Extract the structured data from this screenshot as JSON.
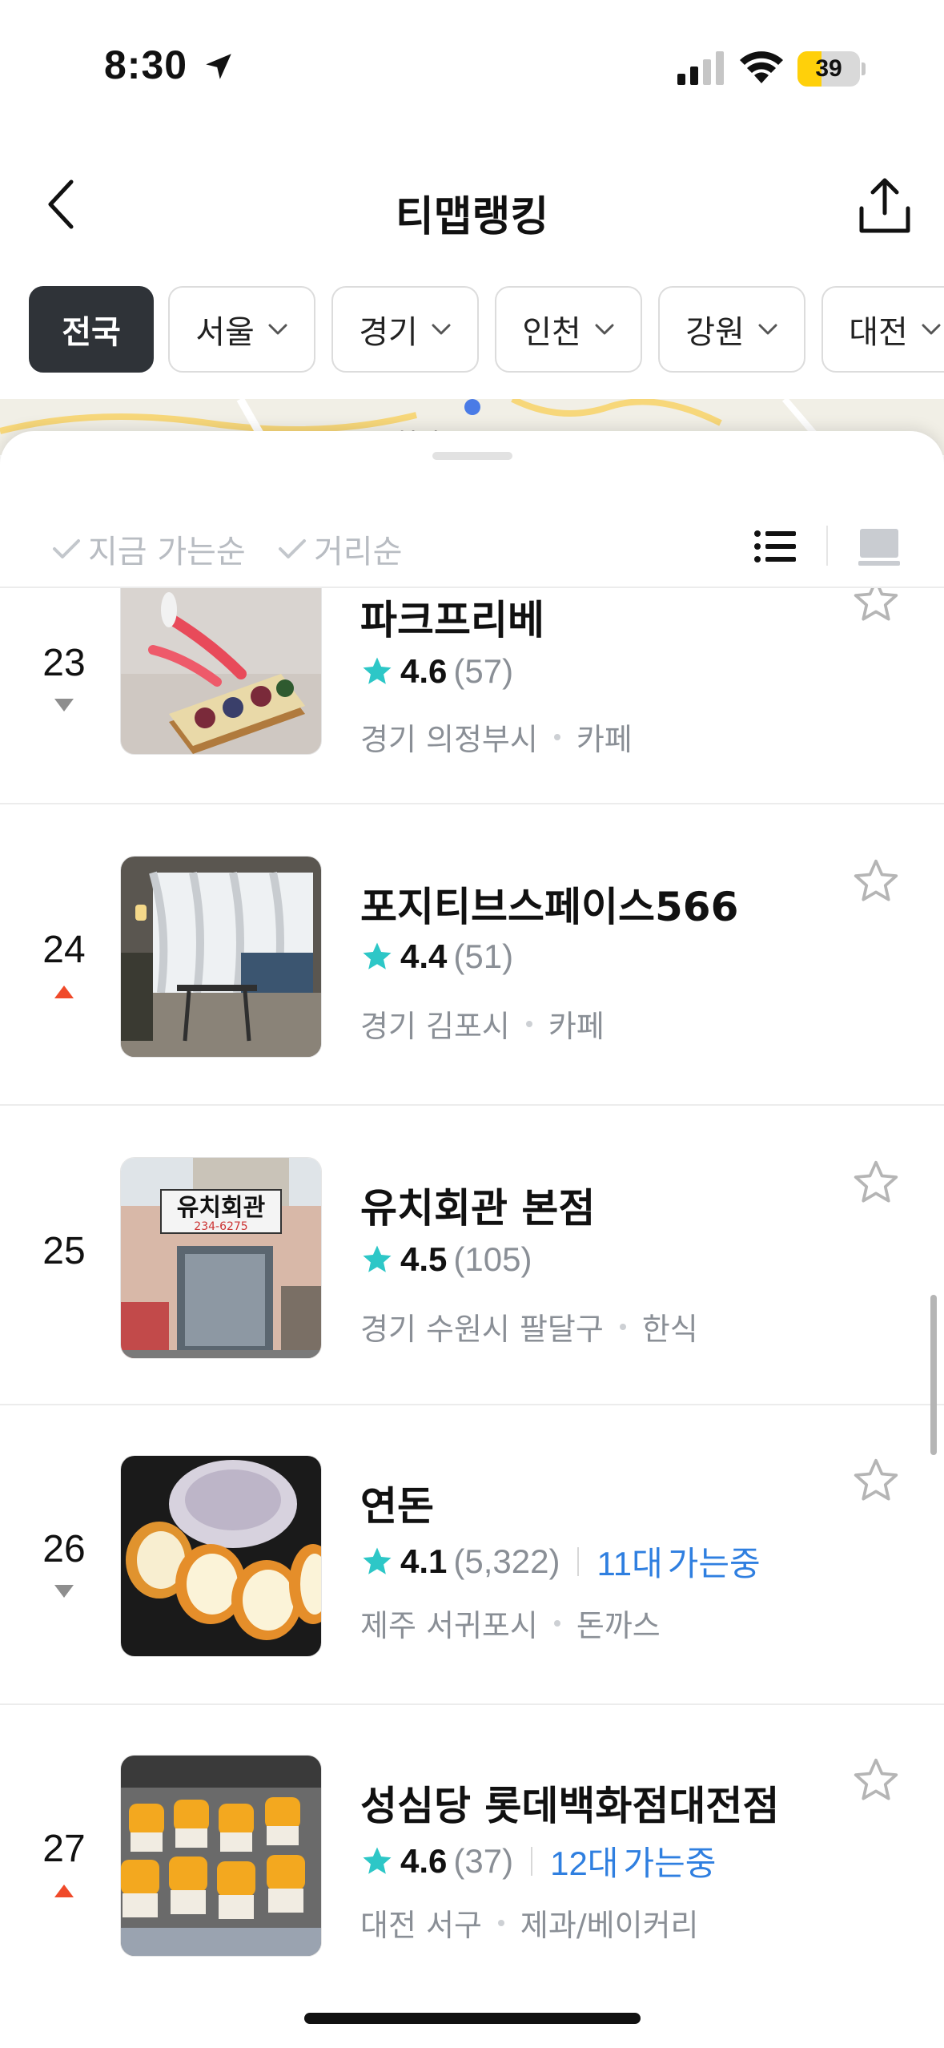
{
  "status_bar": {
    "time": "8:30",
    "battery": "39",
    "battery_level": 0.39,
    "icons": [
      "location-arrow-icon",
      "cellular-signal-icon",
      "wifi-icon",
      "battery-icon"
    ]
  },
  "header": {
    "title": "티맵랭킹",
    "back_icon": "chevron-left-icon",
    "share_icon": "share-icon"
  },
  "region_chips": [
    {
      "label": "전국",
      "active": true
    },
    {
      "label": "서울",
      "active": false
    },
    {
      "label": "경기",
      "active": false
    },
    {
      "label": "인천",
      "active": false
    },
    {
      "label": "강원",
      "active": false
    },
    {
      "label": "대전",
      "active": false
    }
  ],
  "map": {
    "visible_label": "천안"
  },
  "sort": {
    "options": [
      "지금 가는순",
      "거리순"
    ],
    "view_icons": [
      "list-view-icon",
      "map-view-icon"
    ]
  },
  "items": [
    {
      "rank": "23",
      "trend": "down",
      "name": "파크프리베",
      "rating": "4.6",
      "reviews": "(57)",
      "region": "경기 의정부시",
      "category": "카페",
      "drive_count": "",
      "drive_label": ""
    },
    {
      "rank": "24",
      "trend": "up",
      "name": "포지티브스페이스566",
      "rating": "4.4",
      "reviews": "(51)",
      "region": "경기 김포시",
      "category": "카페",
      "drive_count": "",
      "drive_label": ""
    },
    {
      "rank": "25",
      "trend": "none",
      "name": "유치회관 본점",
      "rating": "4.5",
      "reviews": "(105)",
      "region": "경기 수원시 팔달구",
      "category": "한식",
      "drive_count": "",
      "drive_label": "",
      "sign_text": "유치회관",
      "sign_phone": "234-6275"
    },
    {
      "rank": "26",
      "trend": "down",
      "name": "연돈",
      "rating": "4.1",
      "reviews": "(5,322)",
      "region": "제주 서귀포시",
      "category": "돈까스",
      "drive_count": "11대",
      "drive_label": "가는중"
    },
    {
      "rank": "27",
      "trend": "up",
      "name": "성심당 롯데백화점대전점",
      "rating": "4.6",
      "reviews": "(37)",
      "region": "대전 서구",
      "category": "제과/베이커리",
      "drive_count": "12대",
      "drive_label": "가는중"
    }
  ],
  "colors": {
    "accent_blue": "#2f7fe0",
    "star_teal": "#2dc7c7",
    "trend_up": "#f04a2a",
    "trend_down": "#8e8e8e",
    "chip_active": "#2f3338"
  }
}
